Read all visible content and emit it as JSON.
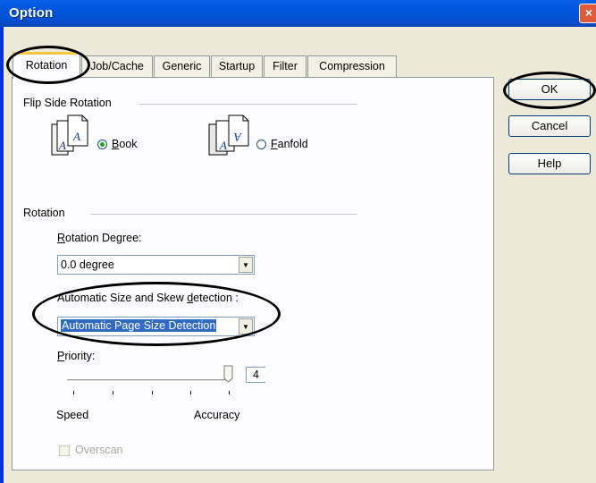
{
  "window": {
    "title": "Option",
    "close_glyph": "×"
  },
  "tabs": [
    {
      "label": "Rotation",
      "active": true
    },
    {
      "label": "Job/Cache",
      "active": false
    },
    {
      "label": "Generic",
      "active": false
    },
    {
      "label": "Startup",
      "active": false
    },
    {
      "label": "Filter",
      "active": false
    },
    {
      "label": "Compression",
      "active": false
    }
  ],
  "flip_side": {
    "group_label": "Flip Side Rotation",
    "book": {
      "label": "Book",
      "mnemonic": "B",
      "rest": "ook",
      "checked": true,
      "icon": "book-pages-icon"
    },
    "fanfold": {
      "label": "Fanfold",
      "mnemonic": "F",
      "rest": "anfold",
      "checked": false,
      "icon": "fanfold-pages-icon"
    }
  },
  "rotation": {
    "group_label": "Rotation",
    "degree_label": "Rotation Degree:",
    "degree_mnemonic": "R",
    "degree_rest": "otation Degree:",
    "degree_value": "0.0 degree",
    "auto_label": "Automatic Size and Skew detection :",
    "auto_label_prefix": "Automatic Size and Skew ",
    "auto_mnemonic": "d",
    "auto_label_suffix": "etection :",
    "auto_value": "Automatic Page Size Detection",
    "priority_label": "Priority:",
    "priority_mnemonic": "P",
    "priority_rest": "riority:",
    "priority_value": "4",
    "speed_label": "Speed",
    "accuracy_label": "Accuracy",
    "overscan_label": "Overscan",
    "overscan_checked": false
  },
  "buttons": {
    "ok": "OK",
    "cancel": "Cancel",
    "help": "Help"
  },
  "colors": {
    "titlebar": "#0450d2",
    "active_tab_accent": "#ffc83c",
    "selection": "#316ac5",
    "radio_dot": "#21a121",
    "annotation": "#000000"
  }
}
